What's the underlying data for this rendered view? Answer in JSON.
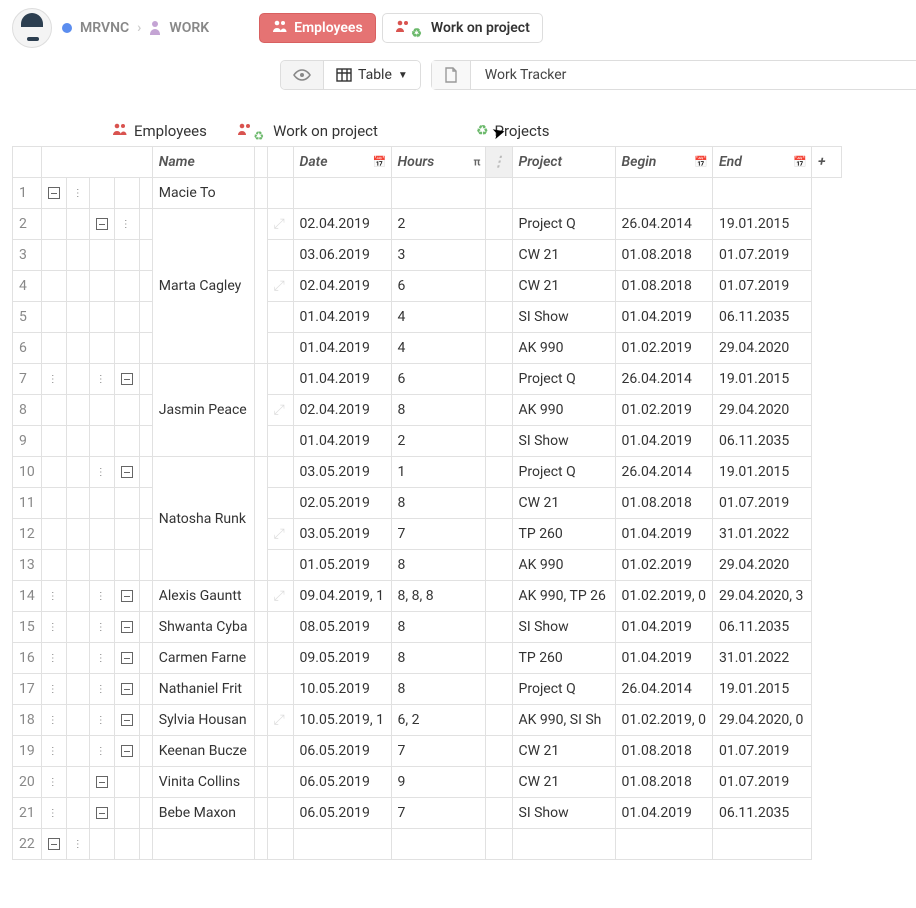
{
  "breadcrumb": {
    "org": "MRVNC",
    "section": "WORK"
  },
  "header_chips": {
    "employees": "Employees",
    "work_on_project": "Work on project"
  },
  "toolbar": {
    "view_label": "Table",
    "doc_title": "Work Tracker"
  },
  "table_tabs": {
    "employees": "Employees",
    "work_on_project": "Work on project",
    "projects": "Projects"
  },
  "columns": {
    "name": "Name",
    "date": "Date",
    "hours": "Hours",
    "project": "Project",
    "begin": "Begin",
    "end": "End"
  },
  "row_numbers": [
    "1",
    "2",
    "3",
    "4",
    "5",
    "6",
    "7",
    "8",
    "9",
    "10",
    "11",
    "12",
    "13",
    "14",
    "15",
    "16",
    "17",
    "18",
    "19",
    "20",
    "21",
    "22"
  ],
  "rows": [
    {
      "n": "1",
      "name": "Macie To",
      "date": "",
      "hours": "",
      "project": "",
      "begin": "",
      "end": "",
      "striped": false,
      "ctrl": [
        "box",
        "ellip",
        "",
        "",
        ""
      ],
      "faint": false
    },
    {
      "n": "2",
      "name": "",
      "date": "02.04.2019",
      "hours": "2",
      "project": "Project Q",
      "begin": "26.04.2014",
      "end": "19.01.2015",
      "striped": true,
      "ctrl": [
        "",
        "",
        "box",
        "ellip",
        ""
      ],
      "faint": true
    },
    {
      "n": "3",
      "name": "",
      "date": "03.06.2019",
      "hours": "3",
      "project": "CW 21",
      "begin": "01.08.2018",
      "end": "01.07.2019",
      "striped": false,
      "ctrl": [
        "",
        "",
        "",
        "",
        ""
      ],
      "faint": false
    },
    {
      "n": "4",
      "name": "Marta Cagley",
      "date": "02.04.2019",
      "hours": "6",
      "project": "CW 21",
      "begin": "01.08.2018",
      "end": "01.07.2019",
      "striped": true,
      "ctrl": [
        "",
        "",
        "",
        "",
        ""
      ],
      "faint": true
    },
    {
      "n": "5",
      "name": "",
      "date": "01.04.2019",
      "hours": "4",
      "project": "SI Show",
      "begin": "01.04.2019",
      "end": "06.11.2035",
      "striped": false,
      "ctrl": [
        "",
        "",
        "",
        "",
        ""
      ],
      "faint": false
    },
    {
      "n": "6",
      "name": "",
      "date": "01.04.2019",
      "hours": "4",
      "project": "AK 990",
      "begin": "01.02.2019",
      "end": "29.04.2020",
      "striped": true,
      "ctrl": [
        "",
        "",
        "",
        "",
        ""
      ],
      "faint": false
    },
    {
      "n": "7",
      "name": "",
      "date": "01.04.2019",
      "hours": "6",
      "project": "Project Q",
      "begin": "26.04.2014",
      "end": "19.01.2015",
      "striped": false,
      "ctrl": [
        "ellip",
        "",
        "ellip",
        "box",
        ""
      ],
      "faint": false
    },
    {
      "n": "8",
      "name": "Jasmin Peace",
      "date": "02.04.2019",
      "hours": "8",
      "project": "AK 990",
      "begin": "01.02.2019",
      "end": "29.04.2020",
      "striped": true,
      "ctrl": [
        "",
        "",
        "",
        "",
        ""
      ],
      "faint": true
    },
    {
      "n": "9",
      "name": "",
      "date": "01.04.2019",
      "hours": "2",
      "project": "SI Show",
      "begin": "01.04.2019",
      "end": "06.11.2035",
      "striped": false,
      "ctrl": [
        "",
        "",
        "",
        "",
        ""
      ],
      "faint": false
    },
    {
      "n": "10",
      "name": "",
      "date": "03.05.2019",
      "hours": "1",
      "project": "Project Q",
      "begin": "26.04.2014",
      "end": "19.01.2015",
      "striped": true,
      "ctrl": [
        "",
        "",
        "ellip",
        "box",
        ""
      ],
      "faint": false
    },
    {
      "n": "11",
      "name": "",
      "date": "02.05.2019",
      "hours": "8",
      "project": "CW 21",
      "begin": "01.08.2018",
      "end": "01.07.2019",
      "striped": false,
      "ctrl": [
        "",
        "",
        "",
        "",
        ""
      ],
      "faint": false
    },
    {
      "n": "12",
      "name": "Natosha Runk",
      "date": "03.05.2019",
      "hours": "7",
      "project": "TP 260",
      "begin": "01.04.2019",
      "end": "31.01.2022",
      "striped": true,
      "ctrl": [
        "",
        "",
        "",
        "",
        ""
      ],
      "faint": true
    },
    {
      "n": "13",
      "name": "",
      "date": "01.05.2019",
      "hours": "8",
      "project": "AK 990",
      "begin": "01.02.2019",
      "end": "29.04.2020",
      "striped": false,
      "ctrl": [
        "",
        "",
        "",
        "",
        ""
      ],
      "faint": false
    },
    {
      "n": "14",
      "name": "Alexis Gauntt",
      "date": "09.04.2019, 1",
      "hours": "8, 8, 8",
      "project": "AK 990, TP 26",
      "begin": "01.02.2019, 0",
      "end": "29.04.2020, 3",
      "striped": false,
      "ctrl": [
        "ellip",
        "",
        "ellip",
        "box",
        ""
      ],
      "faint": true
    },
    {
      "n": "15",
      "name": "Shwanta Cyba",
      "date": "08.05.2019",
      "hours": "8",
      "project": "SI Show",
      "begin": "01.04.2019",
      "end": "06.11.2035",
      "striped": true,
      "ctrl": [
        "ellip",
        "",
        "ellip",
        "box",
        ""
      ],
      "faint": false
    },
    {
      "n": "16",
      "name": "Carmen Farne",
      "date": "09.05.2019",
      "hours": "8",
      "project": "TP 260",
      "begin": "01.04.2019",
      "end": "31.01.2022",
      "striped": false,
      "ctrl": [
        "ellip",
        "",
        "ellip",
        "box",
        ""
      ],
      "faint": false
    },
    {
      "n": "17",
      "name": "Nathaniel Frit",
      "date": "10.05.2019",
      "hours": "8",
      "project": "Project Q",
      "begin": "26.04.2014",
      "end": "19.01.2015",
      "striped": true,
      "ctrl": [
        "ellip",
        "",
        "ellip",
        "box",
        ""
      ],
      "faint": false
    },
    {
      "n": "18",
      "name": "Sylvia Housan",
      "date": "10.05.2019, 1",
      "hours": "6, 2",
      "project": "AK 990, SI Sh",
      "begin": "01.02.2019, 0",
      "end": "29.04.2020, 0",
      "striped": false,
      "ctrl": [
        "ellip",
        "",
        "ellip",
        "box",
        ""
      ],
      "faint": true
    },
    {
      "n": "19",
      "name": "Keenan Bucze",
      "date": "06.05.2019",
      "hours": "7",
      "project": "CW 21",
      "begin": "01.08.2018",
      "end": "01.07.2019",
      "striped": true,
      "ctrl": [
        "ellip",
        "",
        "ellip",
        "box",
        ""
      ],
      "faint": false
    },
    {
      "n": "20",
      "name": "Vinita Collins",
      "date": "06.05.2019",
      "hours": "9",
      "project": "CW 21",
      "begin": "01.08.2018",
      "end": "01.07.2019",
      "striped": false,
      "ctrl": [
        "ellip",
        "",
        "box",
        "",
        ""
      ],
      "faint": false
    },
    {
      "n": "21",
      "name": "Bebe Maxon",
      "date": "06.05.2019",
      "hours": "7",
      "project": "SI Show",
      "begin": "01.04.2019",
      "end": "06.11.2035",
      "striped": true,
      "ctrl": [
        "ellip",
        "",
        "box",
        "",
        ""
      ],
      "faint": false
    },
    {
      "n": "22",
      "name": "",
      "date": "",
      "hours": "",
      "project": "",
      "begin": "",
      "end": "",
      "striped": false,
      "ctrl": [
        "box",
        "ellip",
        "",
        "",
        ""
      ],
      "faint": false
    }
  ]
}
